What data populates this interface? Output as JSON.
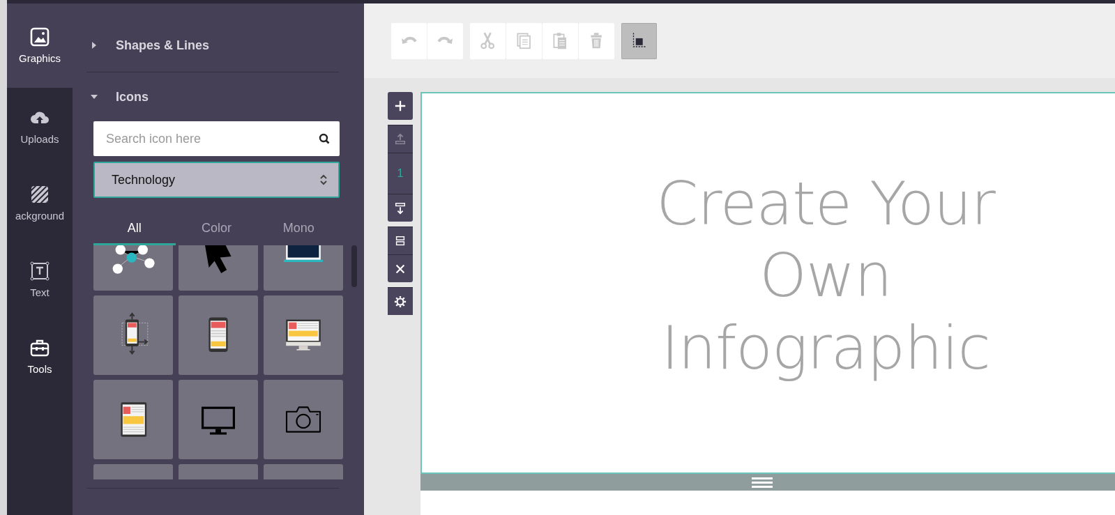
{
  "nav": [
    {
      "label": "Graphics",
      "selected": true
    },
    {
      "label": "Uploads",
      "selected": false
    },
    {
      "label": "ackground",
      "selected": false
    },
    {
      "label": "Text",
      "selected": false
    },
    {
      "label": "Tools",
      "selected": false
    }
  ],
  "panel": {
    "sections": [
      {
        "title": "Shapes & Lines",
        "expanded": false
      },
      {
        "title": "Icons",
        "expanded": true
      }
    ],
    "search": {
      "placeholder": "Search icon here"
    },
    "category": {
      "value": "Technology"
    },
    "filters": [
      {
        "label": "All",
        "selected": true
      },
      {
        "label": "Color",
        "selected": false
      },
      {
        "label": "Mono",
        "selected": false
      }
    ]
  },
  "toolbar": {
    "groups": [
      [
        {
          "kind": "undo",
          "disabled": true
        },
        {
          "kind": "redo",
          "disabled": true
        }
      ],
      [
        {
          "kind": "cut",
          "disabled": true
        },
        {
          "kind": "copy",
          "disabled": true
        },
        {
          "kind": "paste",
          "disabled": true
        },
        {
          "kind": "delete",
          "disabled": true
        }
      ],
      [
        {
          "kind": "position",
          "disabled": false,
          "selected": true
        }
      ]
    ]
  },
  "page_tools": [
    {
      "kind": "add",
      "disabled": false
    },
    {
      "kind": "up",
      "disabled": true
    },
    {
      "kind": "number",
      "text": "1"
    },
    {
      "kind": "down",
      "disabled": false
    },
    {
      "kind": "split",
      "disabled": false
    },
    {
      "kind": "remove",
      "disabled": false
    },
    {
      "kind": "settings",
      "disabled": false
    }
  ],
  "canvas": {
    "headline": "Create Your Own Infographic"
  }
}
